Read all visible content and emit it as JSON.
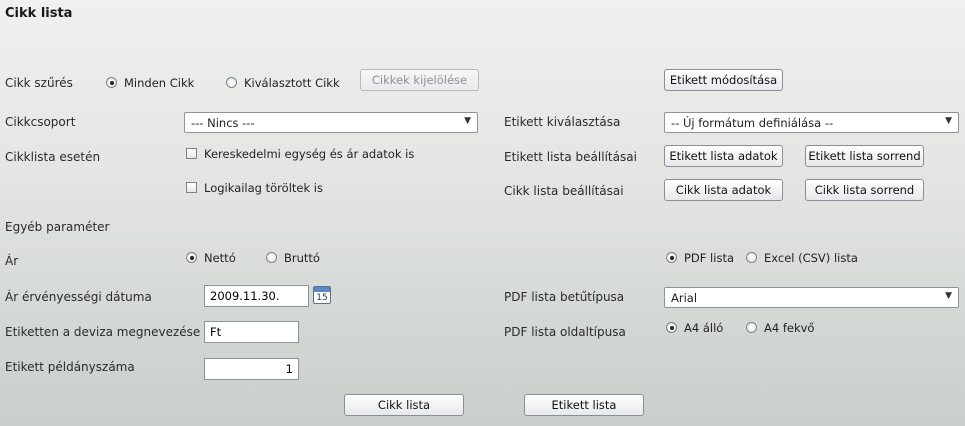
{
  "page": {
    "title": "Cikk lista"
  },
  "filter": {
    "label": "Cikk szűrés",
    "opt_all": "Minden Cikk",
    "opt_selected": "Kiválasztott Cikk",
    "select_button": "Cikkek kijelölése",
    "selected": "all"
  },
  "label_modify_button": "Etikett módosítása",
  "group": {
    "label": "Cikkcsoport",
    "value": "--- Nincs ---"
  },
  "label_select": {
    "label": "Etikett kiválasztása",
    "value": "-- Új formátum definiálása --"
  },
  "list_options": {
    "label": "Cikklista esetén",
    "check_commercial": "Kereskedelmi egység és ár adatok is",
    "check_deleted": "Logikailag töröltek is",
    "commercial_checked": false,
    "deleted_checked": false
  },
  "label_list_settings": {
    "label": "Etikett lista beállításai",
    "data_button": "Etikett lista adatok",
    "order_button": "Etikett lista sorrend"
  },
  "item_list_settings": {
    "label": "Cikk lista beállításai",
    "data_button": "Cikk lista adatok",
    "order_button": "Cikk lista sorrend"
  },
  "other_params": {
    "label": "Egyéb paraméter"
  },
  "price": {
    "label": "Ár",
    "opt_net": "Nettó",
    "opt_gross": "Bruttó",
    "selected": "net"
  },
  "output_format": {
    "opt_pdf": "PDF lista",
    "opt_excel": "Excel (CSV) lista",
    "selected": "pdf"
  },
  "price_date": {
    "label": "Ár érvényességi dátuma",
    "value": "2009.11.30.",
    "calendar_day": "15"
  },
  "pdf_font": {
    "label": "PDF lista betűtípusa",
    "value": "Arial"
  },
  "currency": {
    "label": "Etiketten a deviza megnevezése",
    "value": "Ft"
  },
  "pdf_page": {
    "label": "PDF lista oldaltípusa",
    "opt_portrait": "A4 álló",
    "opt_landscape": "A4 fekvő",
    "selected": "portrait"
  },
  "copies": {
    "label": "Etikett példányszáma",
    "value": "1"
  },
  "actions": {
    "item_list": "Cikk lista",
    "label_list": "Etikett lista"
  },
  "icons": {
    "dropdown": "dropdown-arrow-icon",
    "calendar": "calendar-icon"
  }
}
